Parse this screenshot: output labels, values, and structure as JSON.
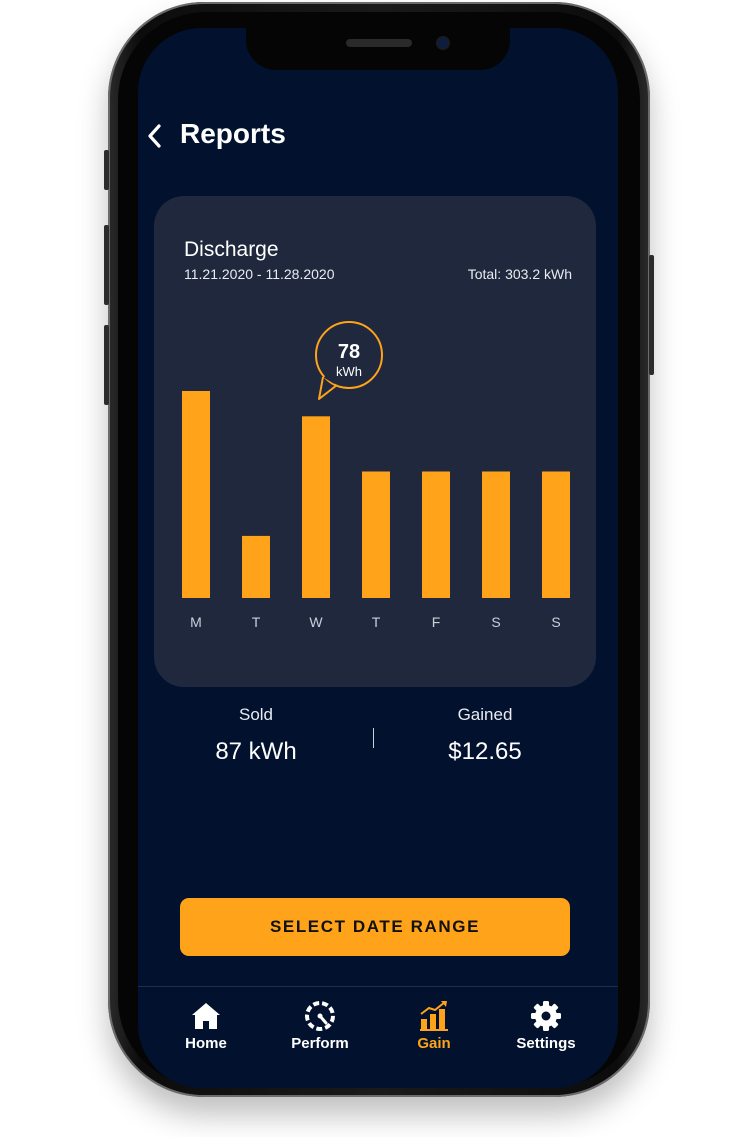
{
  "header": {
    "title": "Reports"
  },
  "card": {
    "title": "Discharge",
    "date_range": "11.21.2020 - 11.28.2020",
    "total": "Total: 303.2 kWh"
  },
  "chart_data": {
    "type": "bar",
    "categories": [
      "M",
      "T",
      "W",
      "T",
      "F",
      "S",
      "S"
    ],
    "values": [
      90,
      27,
      79,
      55,
      55,
      55,
      55
    ],
    "ylim": [
      0,
      100
    ],
    "bar_color": "#ffa31a",
    "tooltip": {
      "category_index": 2,
      "value": "78",
      "unit": "kWh"
    }
  },
  "stats": {
    "sold": {
      "label": "Sold",
      "value": "87 kWh"
    },
    "gained": {
      "label": "Gained",
      "value": "$12.65"
    }
  },
  "cta": {
    "label": "SELECT DATE RANGE"
  },
  "tabs": [
    {
      "label": "Home",
      "icon": "home-icon",
      "active": false
    },
    {
      "label": "Perform",
      "icon": "speedometer-icon",
      "active": false
    },
    {
      "label": "Gain",
      "icon": "bar-chart-icon",
      "active": true
    },
    {
      "label": "Settings",
      "icon": "gear-icon",
      "active": false
    }
  ],
  "colors": {
    "background": "#02112e",
    "card": "#1f283d",
    "accent": "#ffa31a"
  }
}
